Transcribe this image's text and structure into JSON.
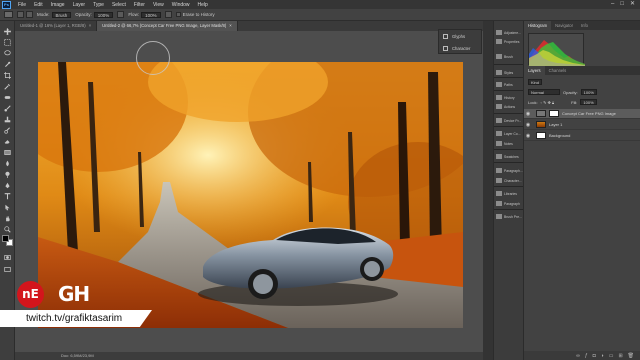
{
  "menubar": {
    "logo": "Ps",
    "items": [
      "File",
      "Edit",
      "Image",
      "Layer",
      "Type",
      "Select",
      "Filter",
      "View",
      "Window",
      "Help"
    ]
  },
  "options": {
    "mode_label": "Mode:",
    "mode_value": "Brush",
    "opacity_label": "Opacity:",
    "opacity_value": "100%",
    "flow_label": "Flow:",
    "flow_value": "100%",
    "erase_label": "Erase to History"
  },
  "tabs": [
    {
      "label": "Untitled-1 @ 16% (Layer 1, RGB/8)",
      "active": false
    },
    {
      "label": "Untitled-2 @ 66,7% (Concept Car Free PNG Image, Layer Mask/8)",
      "active": true
    }
  ],
  "float_panel": {
    "glyphs": "Glyphs",
    "character": "Character"
  },
  "dock": [
    {
      "label": "Adjustme..."
    },
    {
      "label": "Properties"
    },
    {
      "label": "Brush"
    },
    {
      "label": "Styles"
    },
    {
      "label": "Paths"
    },
    {
      "label": "History"
    },
    {
      "label": "Actions"
    },
    {
      "label": "Device Pr..."
    },
    {
      "label": "Layer Co..."
    },
    {
      "label": "Notes"
    },
    {
      "label": "Swatches"
    },
    {
      "label": "Paragraph..."
    },
    {
      "label": "Character..."
    },
    {
      "label": "Libraries"
    },
    {
      "label": "Paragraph"
    },
    {
      "label": "Brush Pre..."
    }
  ],
  "right_panel": {
    "top_tabs": [
      "Histogram",
      "Navigator",
      "Info"
    ],
    "layer_tabs": [
      "Layers",
      "Channels"
    ],
    "kind_label": "Kind",
    "blend_mode": "Normal",
    "opacity_label": "Opacity:",
    "opacity_value": "100%",
    "lock_label": "Lock:",
    "fill_label": "Fill:",
    "fill_value": "100%",
    "layers": [
      {
        "name": "Concept Car Free PNG Image",
        "selected": true
      },
      {
        "name": "Layer 1",
        "selected": false
      },
      {
        "name": "Background",
        "selected": false
      }
    ]
  },
  "status": {
    "text": "Doc: 6,59M/23,9M"
  },
  "watermark": {
    "badge": "nE",
    "logo": "GH",
    "url": "twitch.tv/grafiktasarim"
  }
}
